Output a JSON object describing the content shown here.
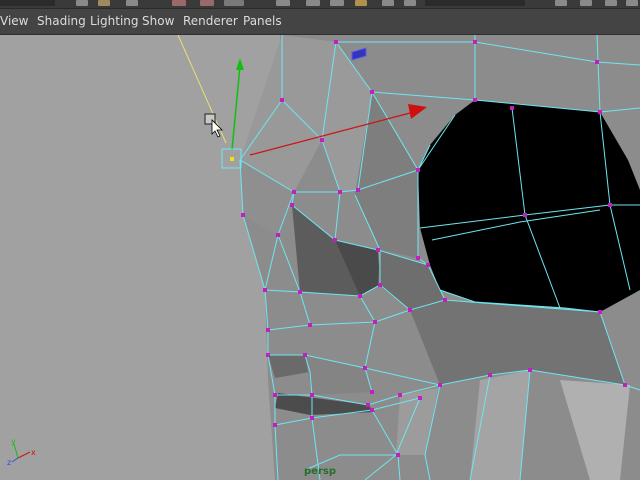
{
  "menubar": {
    "items": [
      {
        "label": "View",
        "name": "menu-view"
      },
      {
        "label": "Shading",
        "name": "menu-shading"
      },
      {
        "label": "Lighting",
        "name": "menu-lighting"
      },
      {
        "label": "Show",
        "name": "menu-show"
      },
      {
        "label": "Renderer",
        "name": "menu-renderer"
      },
      {
        "label": "Panels",
        "name": "menu-panels"
      }
    ]
  },
  "viewport": {
    "camera_label": "persp",
    "axis_labels": {
      "x": "x",
      "y": "y",
      "z": "z"
    },
    "colors": {
      "background": "#a1a1a1",
      "wireframe": "#6ee6f0",
      "vertex": "#c020c0",
      "x_axis": "#d01010",
      "y_axis": "#10c010",
      "mesh_light": "#8a8a8a",
      "mesh_dark": "#5a5a5a",
      "hole": "#000000"
    },
    "icons": [
      "move-manipulator-icon",
      "selected-vertex-icon",
      "cursor-arrow-icon",
      "axis-triad-icon"
    ]
  }
}
